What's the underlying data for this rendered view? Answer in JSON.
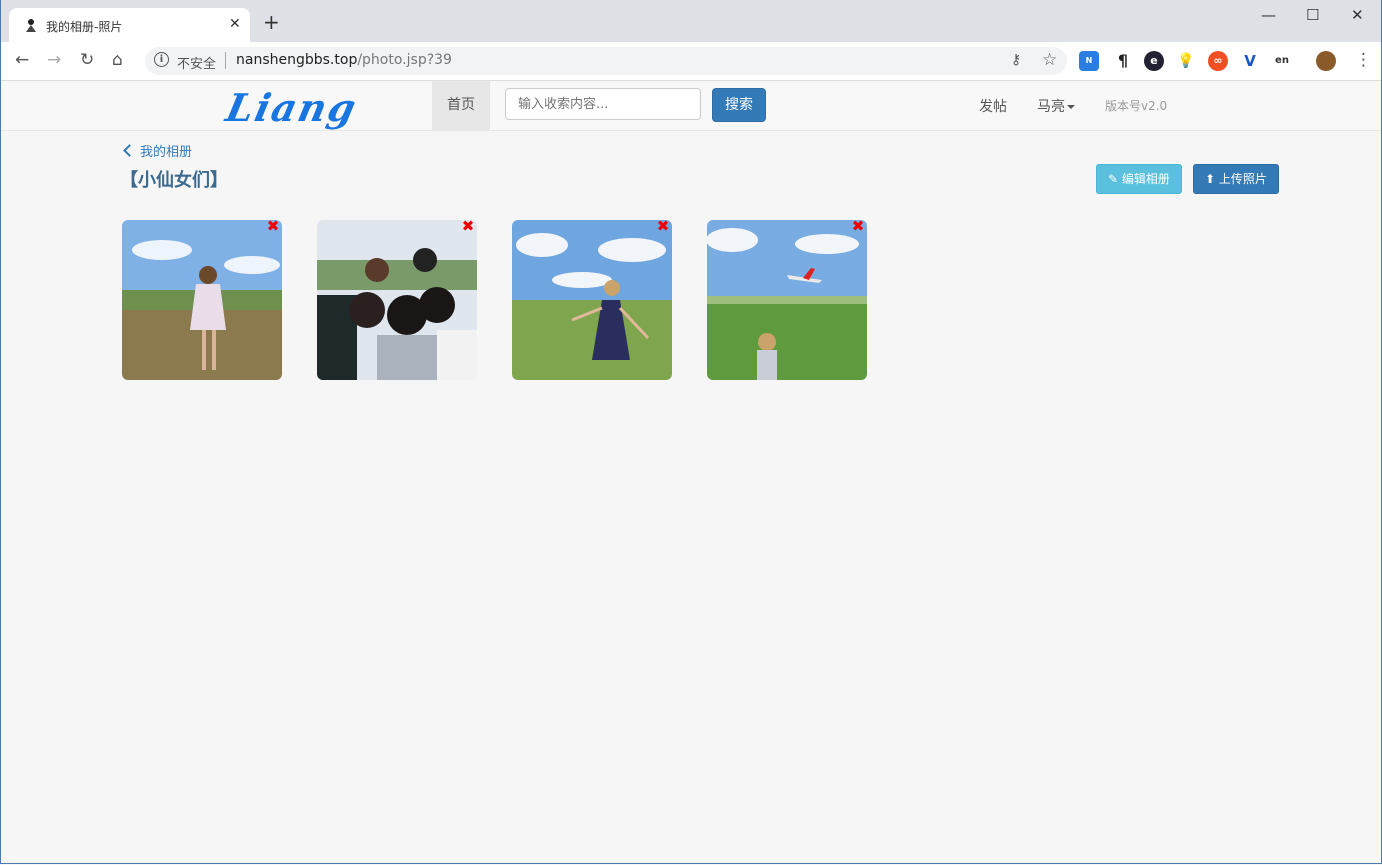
{
  "browser": {
    "tab_title": "我的相册-照片",
    "tab_close": "✕",
    "new_tab": "+",
    "insecure_label": "不安全",
    "url_host": "nanshengbbs.top",
    "url_path": "/photo.jsp?39",
    "window_controls": [
      "—",
      "☐",
      "✕"
    ]
  },
  "navbar": {
    "logo": "Liang",
    "home": "首页",
    "search_placeholder": "输入收索内容...",
    "search_button": "搜索",
    "post": "发帖",
    "user": "马亮",
    "version": "版本号v2.0"
  },
  "page": {
    "back_link": "我的相册",
    "album_title": "【小仙女们】",
    "edit_button": "编辑相册",
    "upload_button": "上传照片",
    "delete_mark": "✖"
  },
  "icons": {
    "edit": "pencil-icon",
    "upload": "upload-arrow-icon",
    "delete": "delete-x-icon"
  },
  "colors": {
    "primary": "#337ab7",
    "info": "#5bc0de",
    "delete": "#e00000",
    "logo": "#1976e0"
  }
}
